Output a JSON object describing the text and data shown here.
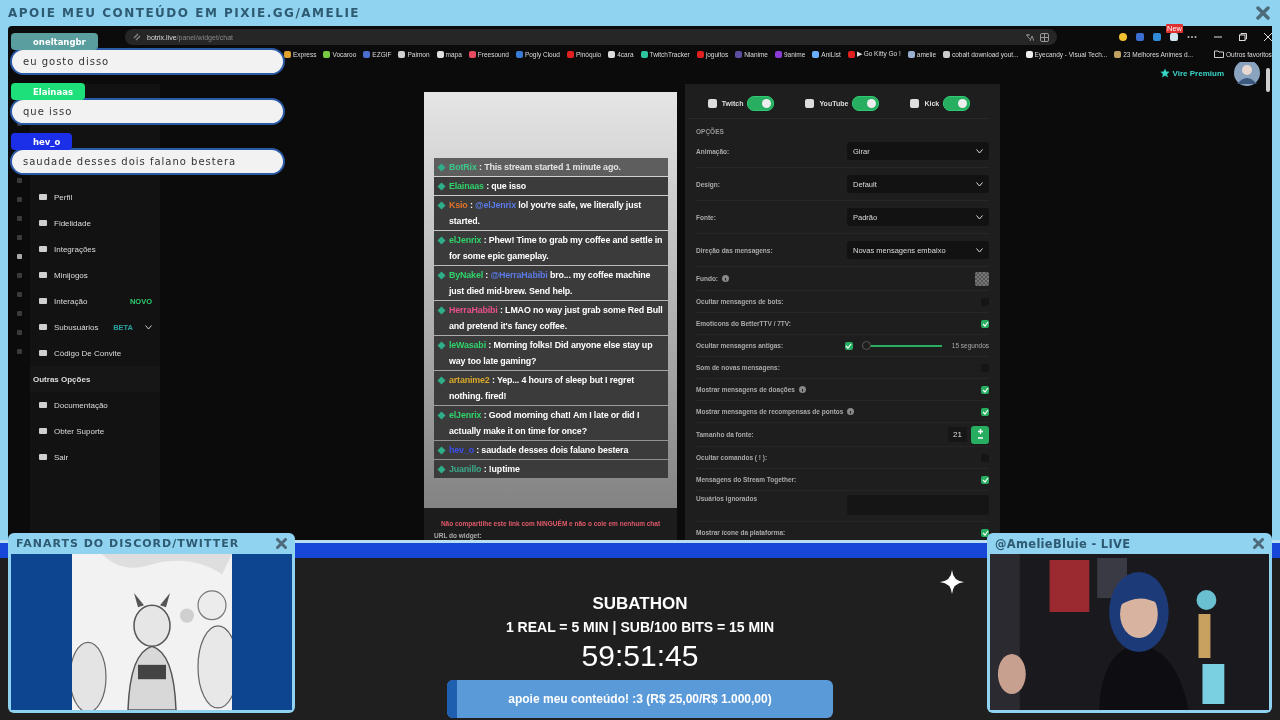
{
  "banner": {
    "title": "APOIE MEU CONTEÚDO EM PIXIE.GG/AMELIE"
  },
  "browser": {
    "address_host": "botrix.live",
    "address_path": "/panel/widget/chat",
    "bookmarks": [
      {
        "label": "Express",
        "color": "#e0a030"
      },
      {
        "label": "Vocaroo",
        "color": "#7ac943"
      },
      {
        "label": "EZGIF",
        "color": "#4a6fd0"
      },
      {
        "label": "Paimon",
        "color": "#d0d0d0"
      },
      {
        "label": "mapa",
        "color": "#e0e0e0"
      },
      {
        "label": "Freesound",
        "color": "#e84a5f"
      },
      {
        "label": "Pogly Cloud",
        "color": "#3a7bd5"
      },
      {
        "label": "Pinóquio",
        "color": "#e02020"
      },
      {
        "label": "4cara",
        "color": "#dddddd"
      },
      {
        "label": "TwitchTracker",
        "color": "#2ec4a0"
      },
      {
        "label": "joguitos",
        "color": "#e02020"
      },
      {
        "label": "Nlanime",
        "color": "#5a4fa0"
      },
      {
        "label": "9anime",
        "color": "#8a3ad5"
      },
      {
        "label": "AniList",
        "color": "#6ab0ff"
      },
      {
        "label": "▶ Go Kitty Go !",
        "color": "#e02020"
      },
      {
        "label": "amelie",
        "color": "#9ab0d0"
      },
      {
        "label": "cobalt download yout...",
        "color": "#cccccc"
      },
      {
        "label": "Eyecandy - Visual Tech...",
        "color": "#eeeeee"
      },
      {
        "label": "23 Melhores Animes d...",
        "color": "#c0a060"
      }
    ],
    "other_bookmarks": "Outros favoritos",
    "new_badge": "New"
  },
  "header": {
    "premium": "Vire Premium"
  },
  "menu": [
    {
      "kind": "item",
      "label": "Perfil"
    },
    {
      "kind": "item",
      "label": "Fidelidade"
    },
    {
      "kind": "item",
      "label": "Integrações"
    },
    {
      "kind": "item",
      "label": "Minijogos"
    },
    {
      "kind": "item",
      "label": "Interação",
      "tag": "NOVO"
    },
    {
      "kind": "item",
      "label": "Subusuários",
      "tag": "BETA",
      "expanded": false
    },
    {
      "kind": "item",
      "label": "Código De Convite"
    },
    {
      "kind": "section",
      "label": "Outras Opções"
    },
    {
      "kind": "item",
      "label": "Documentação"
    },
    {
      "kind": "item",
      "label": "Obter Suporte"
    },
    {
      "kind": "item",
      "label": "Sair"
    }
  ],
  "overlay_chat": [
    {
      "user": "oneltangbr",
      "color": "#5a9ea0",
      "text": "eu gosto disso"
    },
    {
      "user": "Elainaas",
      "color": "#1ee07a",
      "text": "que isso"
    },
    {
      "user": "hev_o",
      "color": "#1c2fe8",
      "text": "saudade desses dois falano bestera"
    }
  ],
  "widget": {
    "messages": [
      {
        "user": "BotRix",
        "color": "#3cc88a",
        "text": "This stream started 1 minute ago.",
        "faded": true
      },
      {
        "user": "Elainaas",
        "color": "#2fd36a",
        "text": "que isso",
        "faded": false
      },
      {
        "user": "Ksio",
        "color": "#e2742a",
        "mention": "@elJenrix",
        "text": "lol you're safe, we literally just started.",
        "faded": false
      },
      {
        "user": "elJenrix",
        "color": "#2fd36a",
        "text": "Phew! Time to grab my coffee and settle in for some epic gameplay.",
        "faded": false
      },
      {
        "user": "ByNakel",
        "color": "#2fd36a",
        "mention": "@HerraHabibi",
        "text": "bro... my coffee machine just died mid-brew. Send help.",
        "faded": false
      },
      {
        "user": "HerraHabibi",
        "color": "#e8508a",
        "text": "LMAO no way just grab some Red Bull and pretend it's fancy coffee.",
        "faded": false
      },
      {
        "user": "leWasabi",
        "color": "#2fd36a",
        "text": "Morning folks! Did anyone else stay up way too late gaming?",
        "faded": false
      },
      {
        "user": "artanime2",
        "color": "#d9a82a",
        "text": "Yep... 4 hours of sleep but I regret nothing. fired!",
        "faded": false
      },
      {
        "user": "elJenrix",
        "color": "#2fd36a",
        "text": "Good morning chat! Am I late or did I actually make it on time for once?",
        "faded": false
      },
      {
        "user": "hev_o",
        "color": "#3a4ff0",
        "text": "saudade desses dois falano bestera",
        "faded": false
      },
      {
        "user": "Juanillo",
        "color": "#3aa88a",
        "text": "!uptime",
        "faded": false
      }
    ],
    "separator": ":",
    "warning": "Não compartilhe este link com NINGUÉM e não o cole em nenhum chat",
    "url_label": "URL do widget:"
  },
  "settings": {
    "platforms": [
      {
        "name": "Twitch",
        "on": true
      },
      {
        "name": "YouTube",
        "on": true
      },
      {
        "name": "Kick",
        "on": true
      }
    ],
    "section": "OPÇÕES",
    "options": [
      {
        "kind": "select",
        "label": "Animação:",
        "value": "Girar"
      },
      {
        "kind": "select",
        "label": "Design:",
        "value": "Default"
      },
      {
        "kind": "select",
        "label": "Fonte:",
        "value": "Padrão"
      },
      {
        "kind": "select",
        "label": "Direção das mensagens:",
        "value": "Novas mensagens embaixo"
      },
      {
        "kind": "swatch",
        "label": "Fundo:",
        "info": true
      },
      {
        "kind": "check",
        "label": "Ocultar mensagens de bots:",
        "checked": false,
        "info": false
      },
      {
        "kind": "check",
        "label": "Emoticons do BetterTTV / 7TV:",
        "checked": true,
        "info": false
      },
      {
        "kind": "slider",
        "label": "Ocultar mensagens antigas:",
        "checked": true,
        "level": 0,
        "reading": "15 segundos"
      },
      {
        "kind": "check",
        "label": "Som de novas mensagens:",
        "checked": false,
        "info": false
      },
      {
        "kind": "check",
        "label": "Mostrar mensagens de doações",
        "checked": true,
        "info": true
      },
      {
        "kind": "check",
        "label": "Mostrar mensagens de recompensas de pontos",
        "checked": true,
        "info": true
      },
      {
        "kind": "number",
        "label": "Tamanho da fonte:",
        "value": "21"
      },
      {
        "kind": "check",
        "label": "Ocultar comandos ( ! ):",
        "checked": false,
        "info": false
      },
      {
        "kind": "check",
        "label": "Mensagens do Stream Together:",
        "checked": true,
        "info": false
      },
      {
        "kind": "text",
        "label": "Usuários ignorados"
      },
      {
        "kind": "check",
        "label": "Mostrar ícone da plataforma:",
        "checked": true,
        "info": false
      }
    ]
  },
  "fanart_window": {
    "title": "FANARTS DO DISCORD/TWITTER",
    "kind": "picture"
  },
  "cam_window": {
    "title": "@AmelieBluie  - LIVE",
    "kind": "picture"
  },
  "subathon": {
    "title": "SUBATHON",
    "rules": "1 REAL = 5 MIN | SUB/100 BITS = 15 MIN",
    "timer": "59:51:45",
    "goal": {
      "label": "apoie meu conteúdo! :3 (R$ 25,00/R$ 1.000,00)",
      "level": 0.025
    }
  }
}
